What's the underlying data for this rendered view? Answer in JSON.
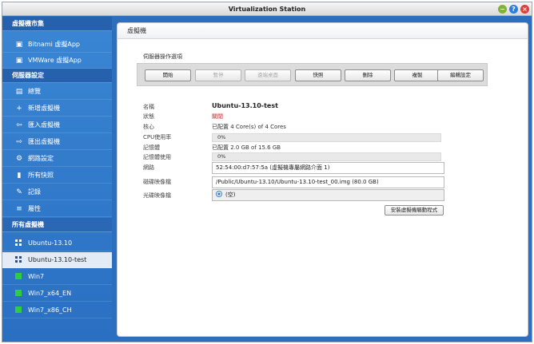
{
  "window": {
    "title": "Virtualization Station",
    "minimize_glyph": "−",
    "help_glyph": "?",
    "close_glyph": "×"
  },
  "sidebar": {
    "group_vm_market": "虛擬機市集",
    "market_items": [
      {
        "label": "Bitnami 虛擬App",
        "icon": "appliance-icon"
      },
      {
        "label": "VMWare 虛擬App",
        "icon": "appliance-icon"
      }
    ],
    "group_server_settings": "伺服器設定",
    "settings_items": [
      {
        "label": "總覽",
        "icon": "overview-icon",
        "glyph": "▤"
      },
      {
        "label": "新增虛擬機",
        "icon": "plus-icon",
        "glyph": "+"
      },
      {
        "label": "匯入虛擬機",
        "icon": "import-icon",
        "glyph": "⇦"
      },
      {
        "label": "匯出虛擬機",
        "icon": "export-icon",
        "glyph": "⇨"
      },
      {
        "label": "網路設定",
        "icon": "network-icon",
        "glyph": "⚙"
      },
      {
        "label": "所有快照",
        "icon": "snapshot-icon",
        "glyph": "▮"
      },
      {
        "label": "記錄",
        "icon": "log-icon",
        "glyph": "✎"
      },
      {
        "label": "屬性",
        "icon": "properties-icon",
        "glyph": "≡"
      }
    ],
    "group_all_vms": "所有虛擬機",
    "vm_items": [
      {
        "label": "Ubuntu-13.10",
        "os": "ubuntu"
      },
      {
        "label": "Ubuntu-13.10-test",
        "os": "ubuntu",
        "selected": true
      },
      {
        "label": "Win7",
        "os": "windows"
      },
      {
        "label": "Win7_x64_EN",
        "os": "windows"
      },
      {
        "label": "Win7_x86_CH",
        "os": "windows"
      }
    ]
  },
  "content": {
    "header": "虛擬機",
    "ops_label": "伺服器操作選項",
    "ops_buttons": [
      {
        "label": "開始",
        "enabled": true
      },
      {
        "label": "暫停",
        "enabled": false
      },
      {
        "label": "遠端桌面",
        "enabled": false
      },
      {
        "label": "快照",
        "enabled": true
      },
      {
        "label": "刪除",
        "enabled": true
      },
      {
        "label": "複製",
        "enabled": true
      },
      {
        "label": "編輯設定",
        "enabled": true
      }
    ],
    "details": {
      "name_label": "名稱",
      "name_value": "Ubuntu-13.10-test",
      "state_label": "狀態",
      "state_value": "關閉",
      "state_color": "#d02020",
      "cores_label": "核心",
      "cores_value": "已配置 4 Core(s) of 4 Cores",
      "cpu_label": "CPU使用率",
      "cpu_value": "0%",
      "memory_label": "記憶體",
      "memory_value": "已配置 2.0 GB of 15.6 GB",
      "memory_usage_label": "記憶體使用",
      "memory_usage_value": "0%",
      "network_label": "網路",
      "network_value": "52:54:00:d7:57:5a (虛擬機專屬網路介面 1)",
      "disk_label": "磁碟映像檔",
      "disk_value": "/Public/Ubuntu-13.10/Ubuntu-13.10-test_00.img (80.0 GB)",
      "cdrom_label": "光碟映像檔",
      "cdrom_value": "(空)"
    },
    "install_driver_button": "安裝虛擬機驅動程式"
  }
}
